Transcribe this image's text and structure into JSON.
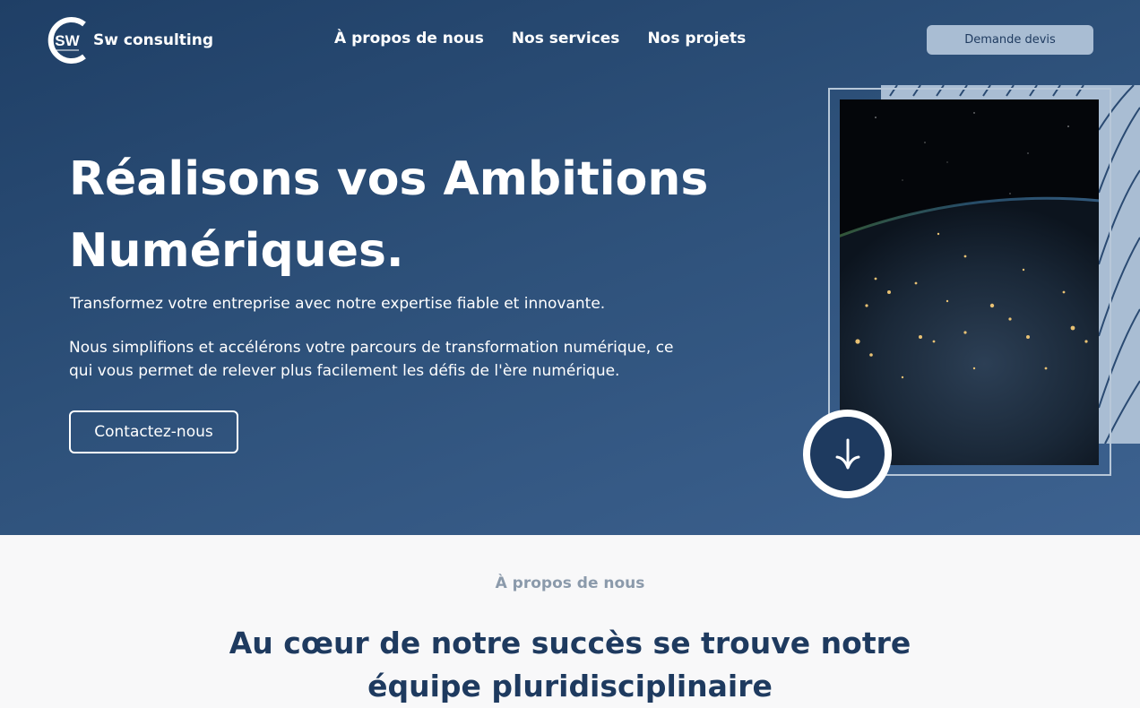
{
  "header": {
    "brand": "Sw consulting",
    "logo_letters": "SW",
    "nav": [
      {
        "label": "À propos de nous"
      },
      {
        "label": "Nos services"
      },
      {
        "label": "Nos projets"
      }
    ],
    "quote_button": "Demande devis"
  },
  "hero": {
    "title": "Réalisons vos Ambitions Numériques.",
    "subtitle": "Transformez votre entreprise avec notre expertise fiable et innovante.",
    "description": "Nous simplifions et accélérons votre parcours de transformation numérique, ce qui vous permet de relever plus facilement les défis de l'ère numérique.",
    "cta": "Contactez-nous",
    "image_icon": "earth-at-night-image",
    "scroll_icon": "arrow-down-icon"
  },
  "about": {
    "label": "À propos de nous",
    "title": "Au cœur de notre succès se trouve notre équipe pluridisciplinaire"
  },
  "colors": {
    "primary": "#1e3a5f",
    "hero_gradient_start": "#1f3f66",
    "hero_gradient_end": "#3d6290",
    "button_light": "#a9bdd3",
    "muted_text": "#8b9aab",
    "page_bg": "#f8f8f9"
  }
}
